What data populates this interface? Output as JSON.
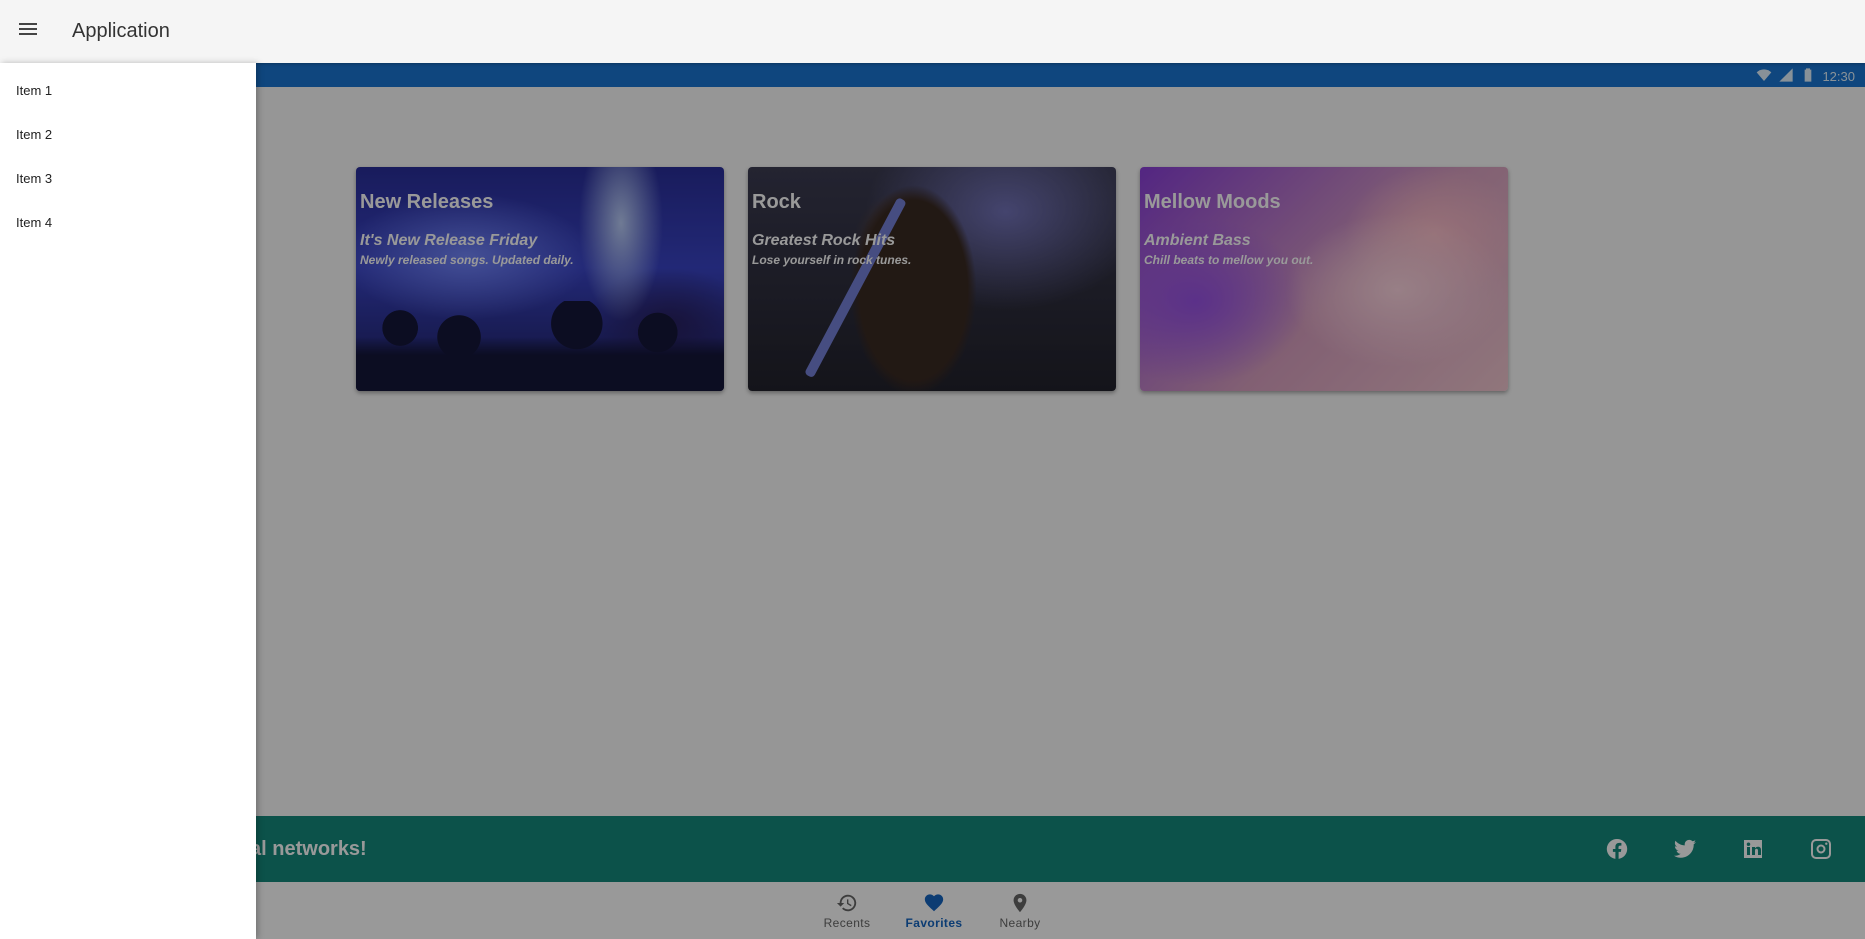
{
  "app_bar": {
    "title": "Application",
    "menu_icon": "menu-icon"
  },
  "status_bar": {
    "time": "12:30",
    "background": "#1976d2"
  },
  "drawer": {
    "items": [
      {
        "label": "Item 1"
      },
      {
        "label": "Item 2"
      },
      {
        "label": "Item 3"
      },
      {
        "label": "Item 4"
      }
    ]
  },
  "cards": [
    {
      "title": "New Releases",
      "subtitle": "It's New Release Friday",
      "description": "Newly released songs. Updated daily."
    },
    {
      "title": "Rock",
      "subtitle": "Greatest Rock Hits",
      "description": "Lose yourself in rock tunes."
    },
    {
      "title": "Mellow Moods",
      "subtitle": "Ambient Bass",
      "description": "Chill beats to mellow you out."
    }
  ],
  "footer": {
    "text": "social networks!",
    "background": "#14897c",
    "social_icons": [
      "facebook-icon",
      "twitter-icon",
      "linkedin-icon",
      "instagram-icon"
    ]
  },
  "bottom_nav": {
    "items": [
      {
        "label": "Recents",
        "icon": "history-icon",
        "active": false
      },
      {
        "label": "Favorites",
        "icon": "heart-icon",
        "active": true
      },
      {
        "label": "Nearby",
        "icon": "location-pin-icon",
        "active": false
      }
    ],
    "active_color": "#1565c0"
  }
}
